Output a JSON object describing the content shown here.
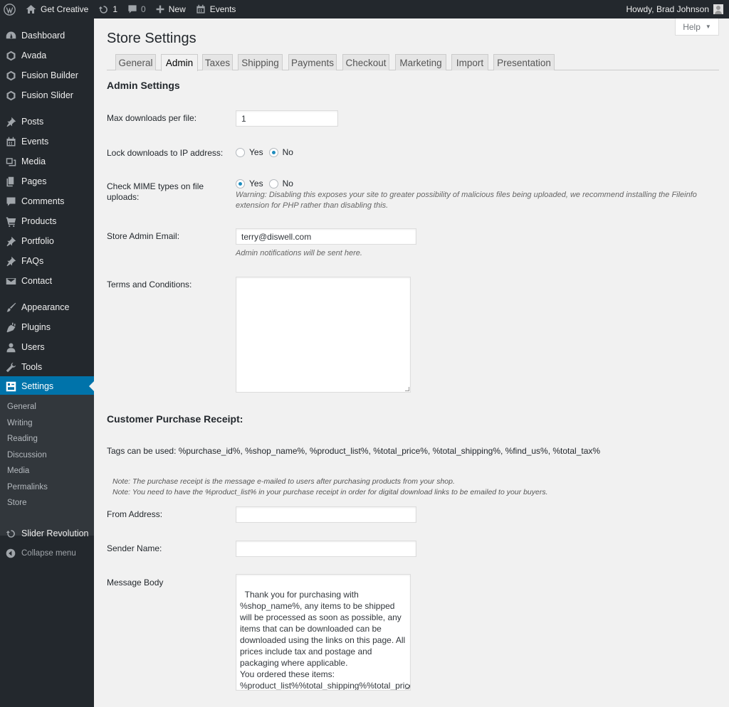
{
  "adminbar": {
    "site_name": "Get Creative",
    "updates_count": "1",
    "comments_count": "0",
    "new_label": "New",
    "events_label": "Events",
    "howdy": "Howdy, Brad Johnson"
  },
  "sidebar": {
    "items": [
      {
        "label": "Dashboard",
        "icon": "dashboard-icon"
      },
      {
        "label": "Avada",
        "icon": "avada-icon"
      },
      {
        "label": "Fusion Builder",
        "icon": "fusion-builder-icon"
      },
      {
        "label": "Fusion Slider",
        "icon": "fusion-slider-icon"
      },
      {
        "label": "Posts",
        "icon": "pin-icon"
      },
      {
        "label": "Events",
        "icon": "calendar-icon"
      },
      {
        "label": "Media",
        "icon": "media-icon"
      },
      {
        "label": "Pages",
        "icon": "pages-icon"
      },
      {
        "label": "Comments",
        "icon": "comment-icon"
      },
      {
        "label": "Products",
        "icon": "cart-icon"
      },
      {
        "label": "Portfolio",
        "icon": "pin-icon"
      },
      {
        "label": "FAQs",
        "icon": "pin-icon"
      },
      {
        "label": "Contact",
        "icon": "mail-icon"
      },
      {
        "label": "Appearance",
        "icon": "brush-icon"
      },
      {
        "label": "Plugins",
        "icon": "plugin-icon"
      },
      {
        "label": "Users",
        "icon": "user-icon"
      },
      {
        "label": "Tools",
        "icon": "wrench-icon"
      },
      {
        "label": "Settings",
        "icon": "settings-icon"
      }
    ],
    "submenu": [
      "General",
      "Writing",
      "Reading",
      "Discussion",
      "Media",
      "Permalinks",
      "Store"
    ],
    "slider_revolution": "Slider Revolution",
    "collapse": "Collapse menu"
  },
  "help": {
    "label": "Help"
  },
  "page": {
    "title": "Store Settings",
    "tabs": [
      "General",
      "Admin",
      "Taxes",
      "Shipping",
      "Payments",
      "Checkout",
      "Marketing",
      "Import",
      "Presentation"
    ],
    "active_tab": "Admin"
  },
  "admin": {
    "heading": "Admin Settings",
    "max_downloads_label": "Max downloads per file:",
    "max_downloads_value": "1",
    "lock_ip_label": "Lock downloads to IP address:",
    "lock_ip_selected": "No",
    "mime_label": "Check MIME types on file uploads:",
    "mime_selected": "Yes",
    "yes": "Yes",
    "no": "No",
    "mime_warning": "Warning: Disabling this exposes your site to greater possibility of malicious files being uploaded, we recommend installing the Fileinfo extension for PHP rather than disabling this.",
    "admin_email_label": "Store Admin Email:",
    "admin_email_value": "terry@diswell.com",
    "admin_email_desc": "Admin notifications will be sent here.",
    "terms_label": "Terms and Conditions:",
    "terms_value": ""
  },
  "receipt": {
    "heading": "Customer Purchase Receipt:",
    "tags": "Tags can be used: %purchase_id%, %shop_name%, %product_list%, %total_price%, %total_shipping%, %find_us%, %total_tax%",
    "note1": "Note: The purchase receipt is the message e-mailed to users after purchasing products from your shop.",
    "note2": "Note: You need to have the %product_list% in your purchase receipt in order for digital download links to be emailed to your buyers.",
    "from_label": "From Address:",
    "from_value": "",
    "sender_label": "Sender Name:",
    "sender_value": "",
    "body_label": "Message Body",
    "body_value": "Thank you for purchasing with %shop_name%, any items to be shipped will be processed as soon as possible, any items that can be downloaded can be downloaded using the links on this page. All prices include tax and postage and packaging where applicable.\nYou ordered these items:\n%product_list%%total_shipping%%total_price%"
  },
  "colors": {
    "adminbar_bg": "#23282d",
    "sidebar_bg": "#23282d",
    "active_menu": "#0073aa",
    "content_bg": "#f1f1f1"
  }
}
